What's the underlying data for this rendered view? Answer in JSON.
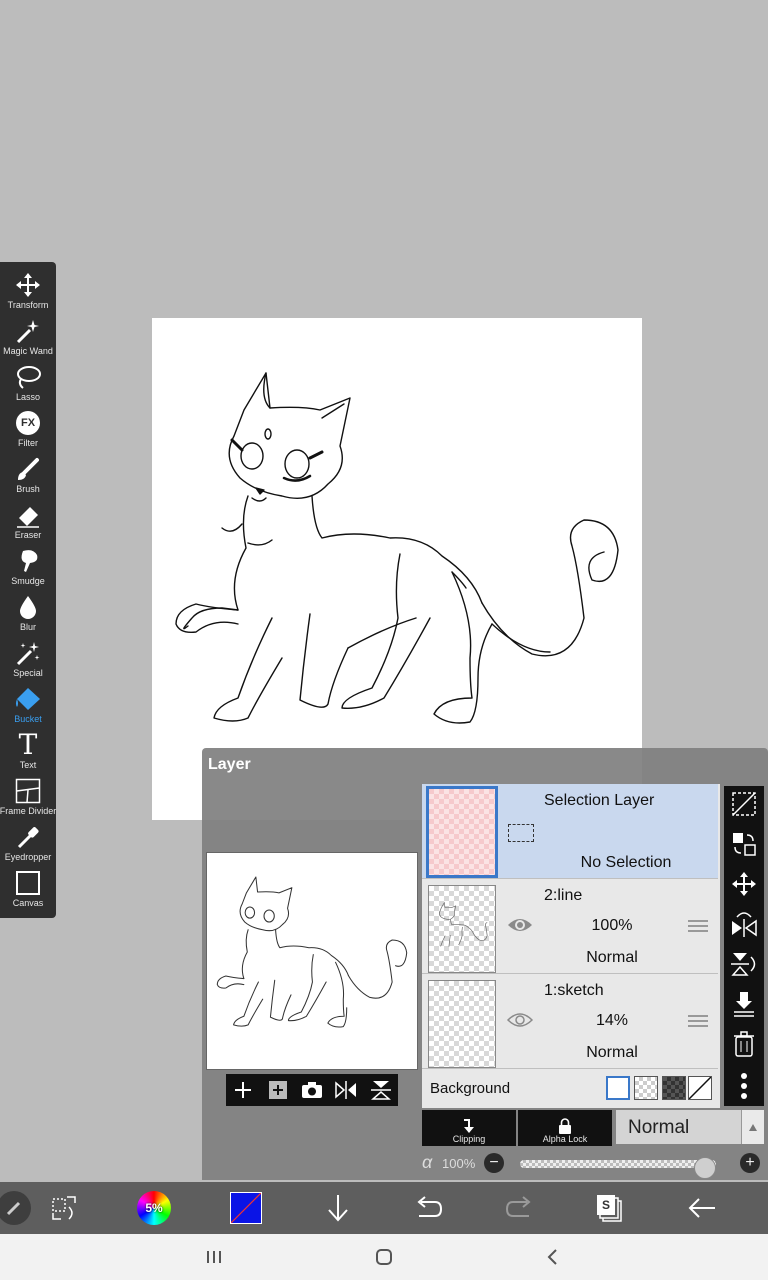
{
  "tools": [
    {
      "label": "Transform",
      "icon": "transform-icon"
    },
    {
      "label": "Magic Wand",
      "icon": "magic-wand-icon"
    },
    {
      "label": "Lasso",
      "icon": "lasso-icon"
    },
    {
      "label": "Filter",
      "icon": "filter-icon"
    },
    {
      "label": "Brush",
      "icon": "brush-icon"
    },
    {
      "label": "Eraser",
      "icon": "eraser-icon"
    },
    {
      "label": "Smudge",
      "icon": "smudge-icon"
    },
    {
      "label": "Blur",
      "icon": "blur-icon"
    },
    {
      "label": "Special",
      "icon": "special-icon"
    },
    {
      "label": "Bucket",
      "icon": "bucket-icon",
      "active": true
    },
    {
      "label": "Text",
      "icon": "text-icon"
    },
    {
      "label": "Frame Divider",
      "icon": "frame-divider-icon"
    },
    {
      "label": "Eyedropper",
      "icon": "eyedropper-icon"
    },
    {
      "label": "Canvas",
      "icon": "canvas-icon"
    }
  ],
  "filter_icon_text": "FX",
  "text_icon_glyph": "T",
  "layer_panel": {
    "title": "Layer",
    "layers": [
      {
        "name": "Selection Layer",
        "status": "No Selection"
      },
      {
        "name": "2:line",
        "opacity": "100%",
        "blend": "Normal"
      },
      {
        "name": "1:sketch",
        "opacity": "14%",
        "blend": "Normal"
      }
    ],
    "background_label": "Background",
    "clipping_label": "Clipping",
    "alpha_lock_label": "Alpha Lock",
    "blend_mode": "Normal",
    "alpha_symbol": "α",
    "alpha_value": "100%",
    "alpha_fraction": 1.0
  },
  "bottom": {
    "color_wheel_text": "5%",
    "primary_color": "#0a14e6"
  },
  "colors": {
    "accent": "#3a9ff0",
    "selection_highlight": "#c9d8ee",
    "toolbar_bg": "#2f2f2f"
  }
}
